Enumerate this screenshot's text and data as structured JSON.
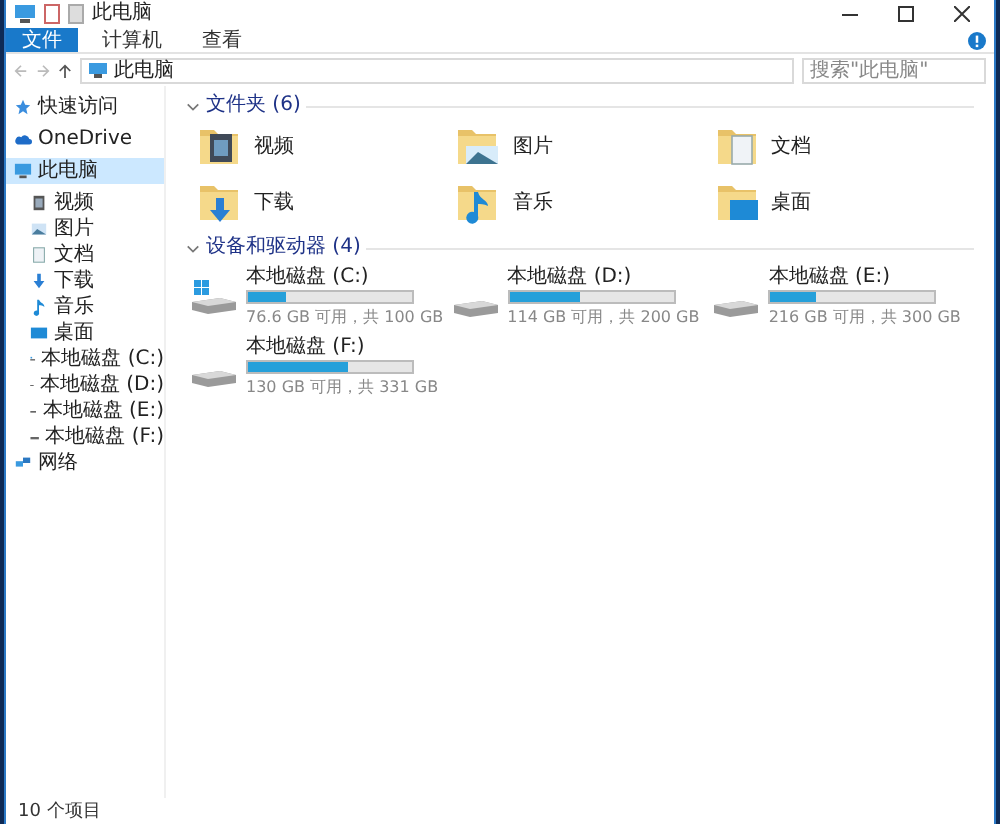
{
  "window": {
    "title": "此电脑"
  },
  "ribbon": {
    "tabs": [
      {
        "label": "文件",
        "selected": true
      },
      {
        "label": "计算机",
        "selected": false
      },
      {
        "label": "查看",
        "selected": false
      }
    ]
  },
  "address": {
    "path": "此电脑"
  },
  "search": {
    "placeholder": "搜索\"此电脑\""
  },
  "sidebar": {
    "items": [
      {
        "label": "快速访问",
        "kind": "star",
        "selected": false
      },
      {
        "label": "OneDrive",
        "kind": "cloud",
        "selected": false
      },
      {
        "label": "此电脑",
        "kind": "pc",
        "selected": true,
        "children": [
          {
            "label": "视频",
            "kind": "video",
            "selected": false
          },
          {
            "label": "图片",
            "kind": "picture",
            "selected": false
          },
          {
            "label": "文档",
            "kind": "document",
            "selected": false
          },
          {
            "label": "下载",
            "kind": "download",
            "selected": false
          },
          {
            "label": "音乐",
            "kind": "music",
            "selected": false
          },
          {
            "label": "桌面",
            "kind": "desktop",
            "selected": false
          },
          {
            "label": "本地磁盘 (C:)",
            "kind": "systemdrive",
            "selected": false
          },
          {
            "label": "本地磁盘 (D:)",
            "kind": "drive",
            "selected": false
          },
          {
            "label": "本地磁盘 (E:)",
            "kind": "drive",
            "selected": false
          },
          {
            "label": "本地磁盘 (F:)",
            "kind": "drive",
            "selected": false
          }
        ]
      },
      {
        "label": "网络",
        "kind": "network",
        "selected": false
      }
    ]
  },
  "folders": {
    "title": "文件夹 (6)",
    "items": [
      {
        "label": "视频",
        "kind": "video"
      },
      {
        "label": "图片",
        "kind": "picture"
      },
      {
        "label": "文档",
        "kind": "document"
      },
      {
        "label": "下载",
        "kind": "download"
      },
      {
        "label": "音乐",
        "kind": "music"
      },
      {
        "label": "桌面",
        "kind": "desktop"
      }
    ]
  },
  "drives": {
    "title": "设备和驱动器 (4)",
    "items": [
      {
        "label": "本地磁盘 (C:)",
        "kind": "systemdrive",
        "level": 0.23,
        "space": "76.6 GB 可用，共 100 GB"
      },
      {
        "label": "本地磁盘 (D:)",
        "kind": "drive",
        "level": 0.43,
        "space": "114 GB 可用，共 200 GB"
      },
      {
        "label": "本地磁盘 (E:)",
        "kind": "drive",
        "level": 0.28,
        "space": "216 GB 可用，共 300 GB"
      },
      {
        "label": "本地磁盘 (F:)",
        "kind": "drive",
        "level": 0.61,
        "space": "130 GB 可用，共 331 GB"
      }
    ]
  },
  "status_bar": {
    "text": "10 个项目"
  }
}
